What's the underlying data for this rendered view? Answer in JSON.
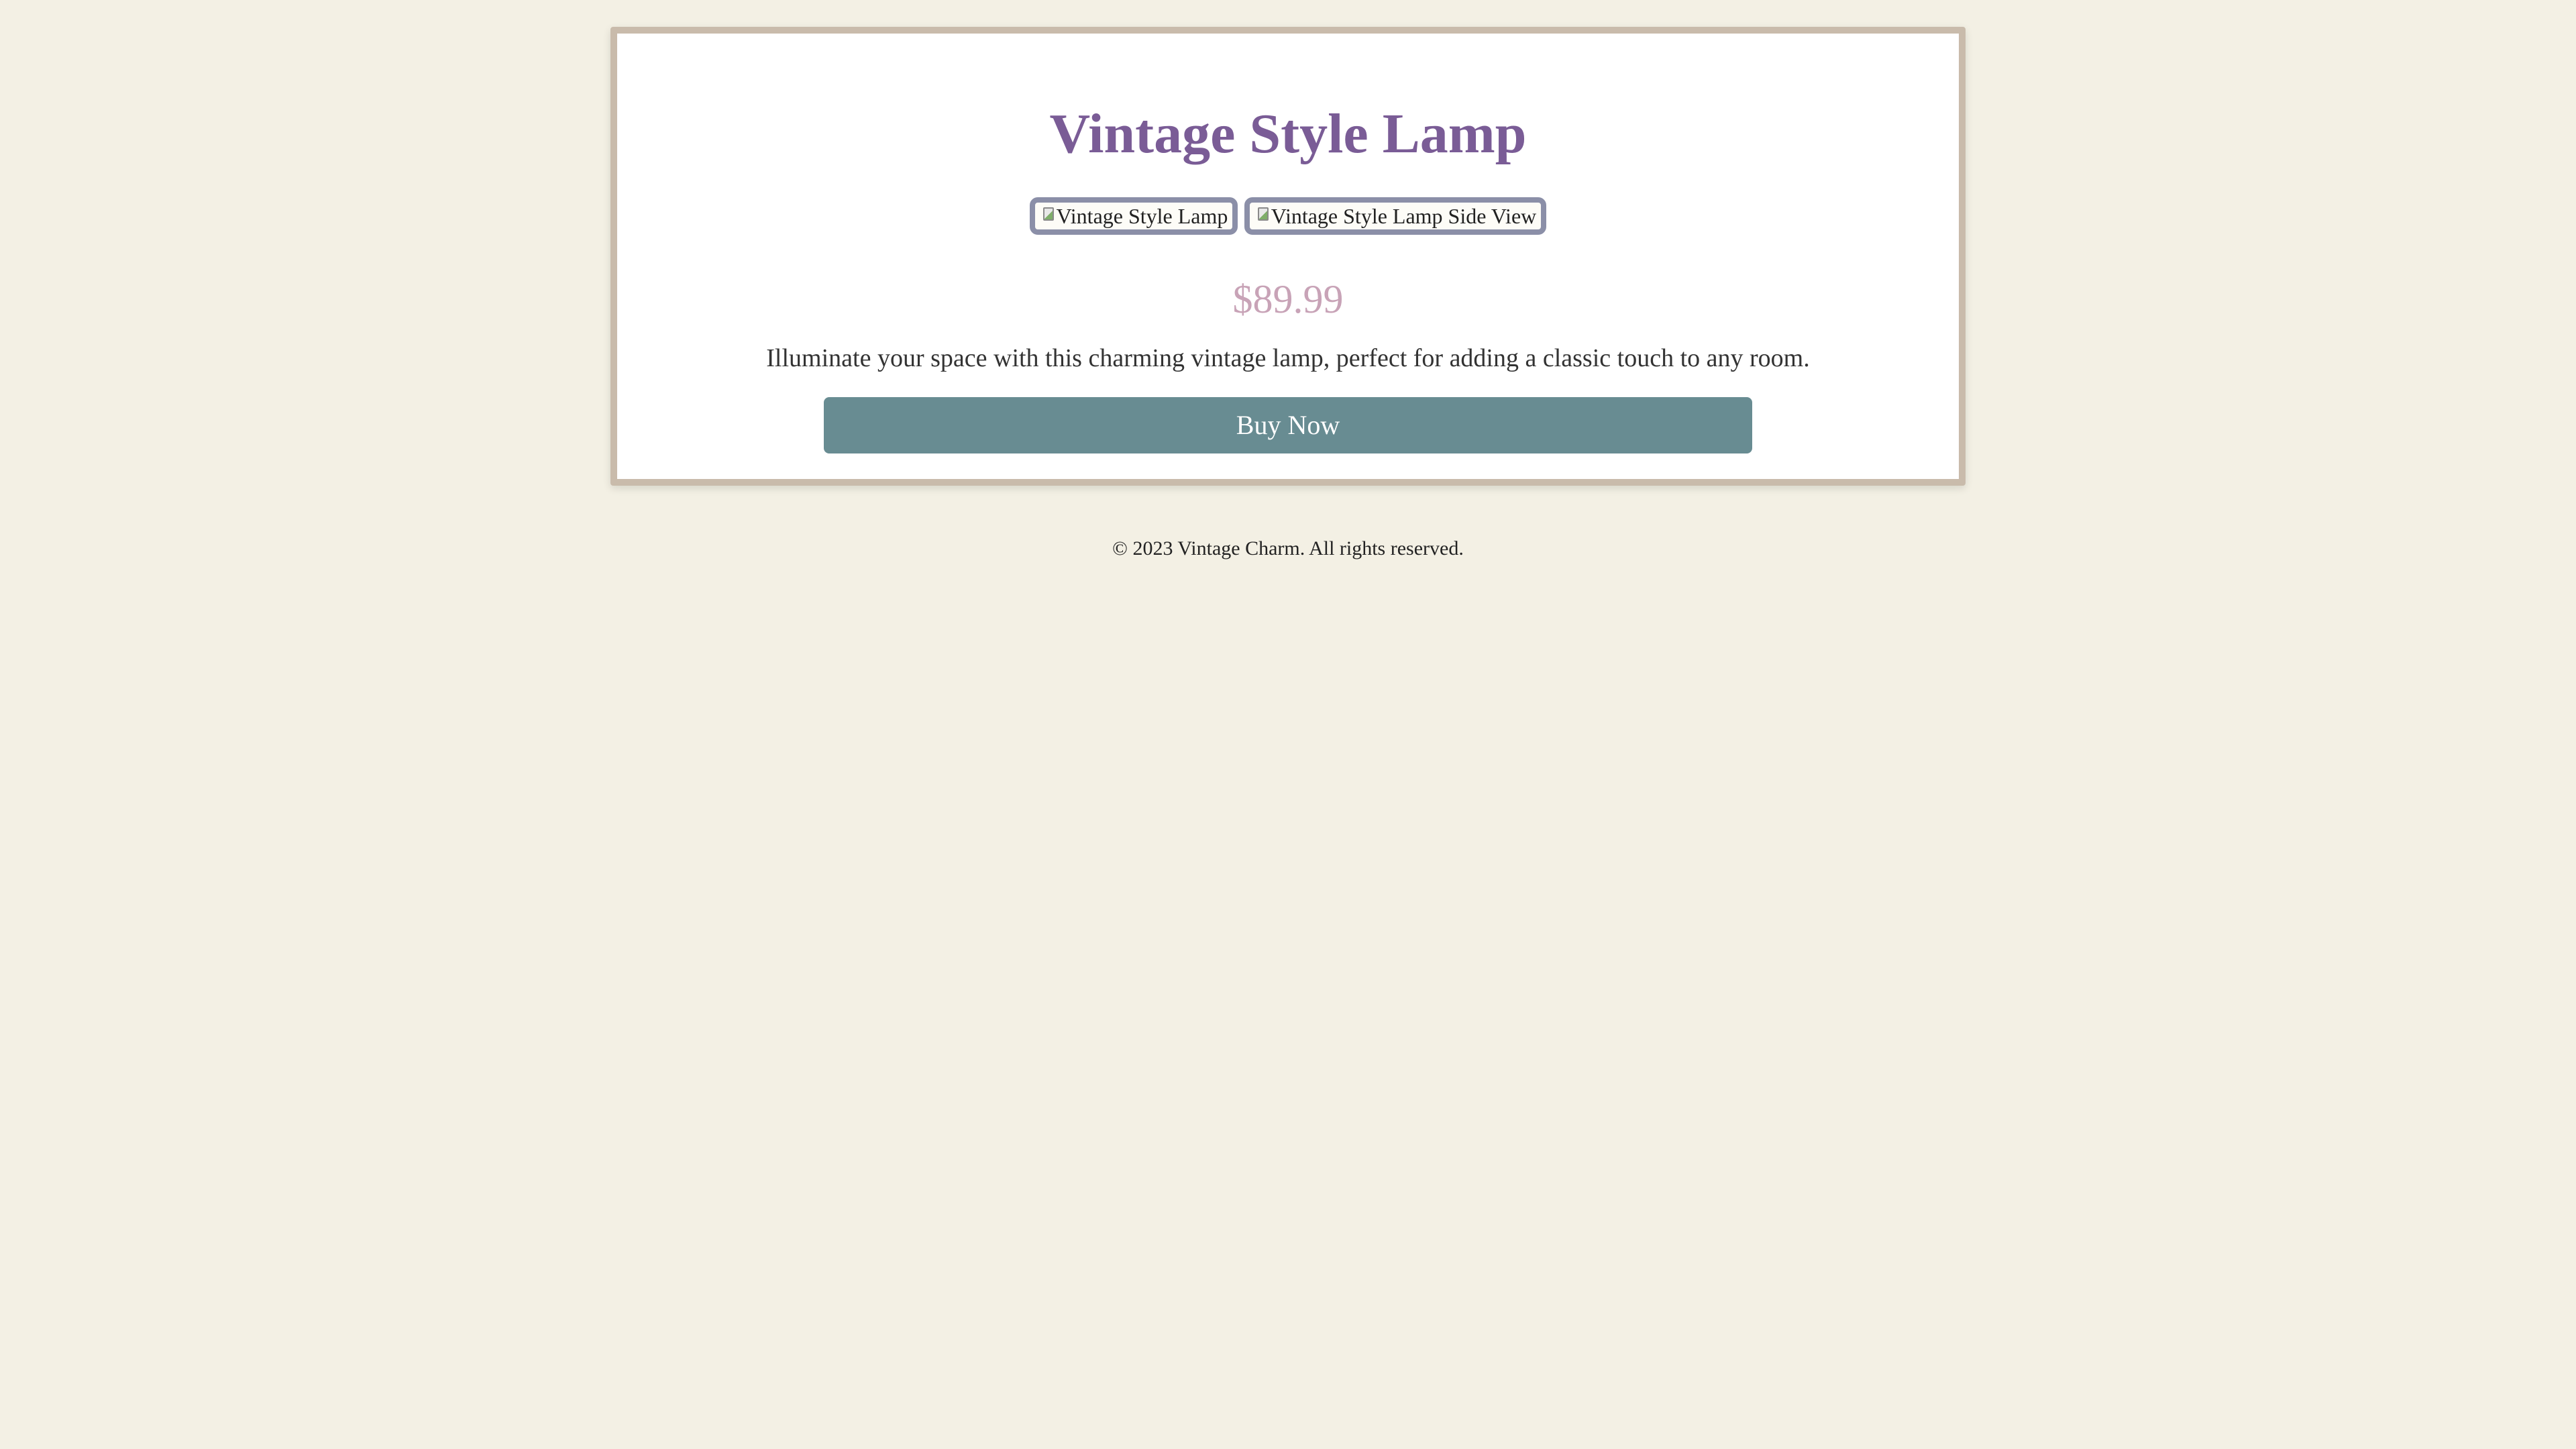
{
  "product": {
    "title": "Vintage Style Lamp",
    "images": [
      {
        "alt": "Vintage Style Lamp",
        "icon": "broken-image-icon"
      },
      {
        "alt": "Vintage Style Lamp Side View",
        "icon": "broken-image-icon"
      }
    ],
    "price": "$89.99",
    "description": "Illuminate your space with this charming vintage lamp, perfect for adding a classic touch to any room.",
    "buy_label": "Buy Now"
  },
  "footer": {
    "text": "© 2023 Vintage Charm. All rights reserved."
  },
  "colors": {
    "background": "#f3f0e4",
    "card_border": "#c9bbab",
    "title": "#7a5c96",
    "thumb_border": "#8b8fa8",
    "price": "#c8a3b7",
    "button": "#688c92"
  }
}
